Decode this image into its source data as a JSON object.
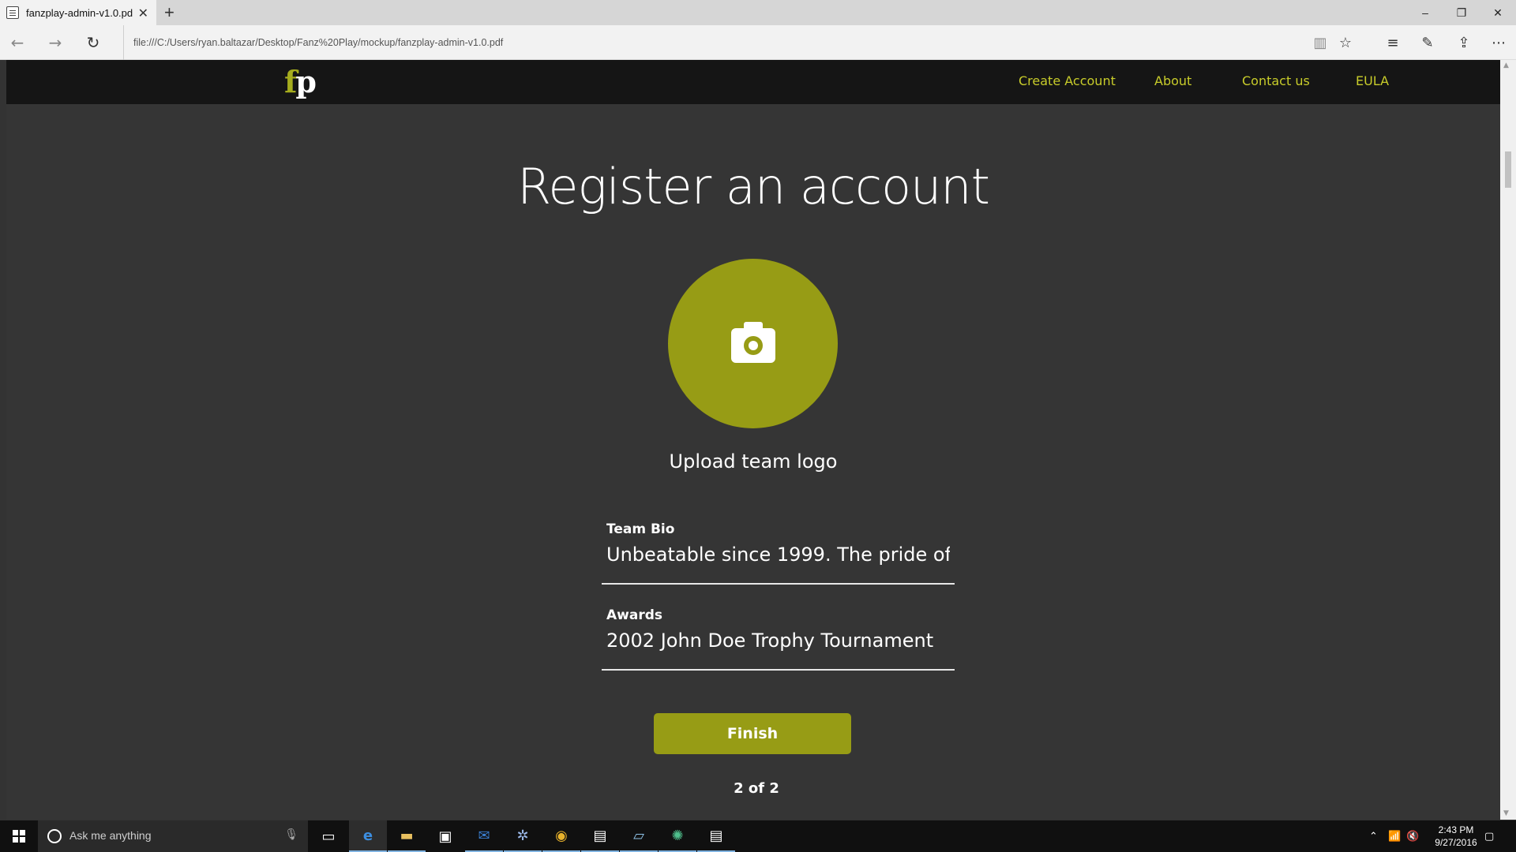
{
  "browser": {
    "tab_title": "fanzplay-admin-v1.0.pd",
    "tab_close": "✕",
    "new_tab": "+",
    "url": "file:///C:/Users/ryan.baltazar/Desktop/Fanz%20Play/mockup/fanzplay-admin-v1.0.pdf",
    "window_controls": {
      "minimize": "–",
      "restore": "❐",
      "close": "✕"
    }
  },
  "site": {
    "logo": {
      "f": "f",
      "p": "p"
    },
    "nav": [
      "Create Account",
      "About",
      "Contact us",
      "EULA"
    ],
    "heading": "Register an account",
    "upload_label": "Upload team logo",
    "fields": [
      {
        "label": "Team Bio",
        "value": "Unbeatable since 1999. The pride of..."
      },
      {
        "label": "Awards",
        "value": "2002 John Doe Trophy Tournament"
      }
    ],
    "finish_label": "Finish",
    "step": "2 of 2",
    "colors": {
      "accent": "#979c15",
      "nav_link": "#c8cc2a",
      "background": "#353535",
      "navbar": "#151515"
    }
  },
  "taskbar": {
    "search_placeholder": "Ask me anything",
    "clock_time": "2:43 PM",
    "clock_date": "9/27/2016"
  }
}
